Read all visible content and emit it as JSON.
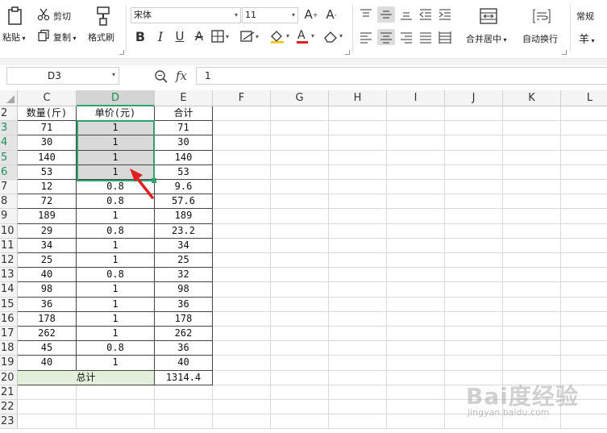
{
  "ribbon": {
    "paste": "粘贴",
    "cut": "剪切",
    "copy": "复制",
    "format_painter": "格式刷",
    "font_name": "宋体",
    "font_size": "11",
    "merge_center": "合并居中",
    "wrap_text": "自动换行",
    "number_format": "常规",
    "currency": "羊"
  },
  "formula_bar": {
    "name_box": "D3",
    "fx": "fx",
    "value": "1"
  },
  "columns": [
    "C",
    "D",
    "E",
    "F",
    "G",
    "H",
    "I",
    "J",
    "K",
    "L"
  ],
  "rows": [
    "2",
    "3",
    "4",
    "5",
    "6",
    "7",
    "8",
    "9",
    "10",
    "11",
    "12",
    "13",
    "14",
    "15",
    "16",
    "17",
    "18",
    "19",
    "20",
    "21",
    "22",
    "23"
  ],
  "table": {
    "headers": [
      "数量(斤)",
      "单价(元)",
      "合计"
    ],
    "data": [
      [
        "71",
        "1",
        "71"
      ],
      [
        "30",
        "1",
        "30"
      ],
      [
        "140",
        "1",
        "140"
      ],
      [
        "53",
        "1",
        "53"
      ],
      [
        "12",
        "0.8",
        "9.6"
      ],
      [
        "72",
        "0.8",
        "57.6"
      ],
      [
        "189",
        "1",
        "189"
      ],
      [
        "29",
        "0.8",
        "23.2"
      ],
      [
        "34",
        "1",
        "34"
      ],
      [
        "25",
        "1",
        "25"
      ],
      [
        "40",
        "0.8",
        "32"
      ],
      [
        "98",
        "1",
        "98"
      ],
      [
        "36",
        "1",
        "36"
      ],
      [
        "178",
        "1",
        "178"
      ],
      [
        "262",
        "1",
        "262"
      ],
      [
        "45",
        "0.8",
        "36"
      ],
      [
        "40",
        "1",
        "40"
      ]
    ],
    "total_label": "总计",
    "total_value": "1314.4"
  },
  "colors": {
    "selection_border": "#2fa36f",
    "selection_fill": "#d9d9d9",
    "total_fill": "#e2efda",
    "arrow": "#e02020",
    "font_color_bar": "#e02020"
  },
  "watermark": {
    "logo": "Bai度经验",
    "url": "jingyan.baidu.com"
  }
}
